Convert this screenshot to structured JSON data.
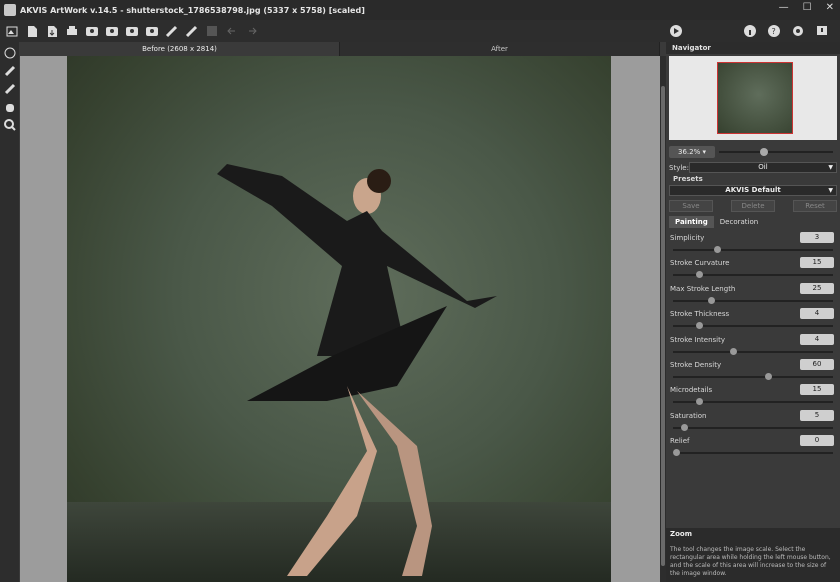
{
  "window": {
    "title": "AKVIS ArtWork v.14.5 - shutterstock_1786538798.jpg (5337 x 5758) [scaled]",
    "controls": [
      "minimize-icon",
      "maximize-icon",
      "close-icon"
    ]
  },
  "toolbar": {
    "icons": [
      "home-icon",
      "open-icon",
      "save-icon",
      "print-icon",
      "import-preset-icon",
      "export-preset-icon",
      "batch-icon",
      "share-icon",
      "brush-settings-icon",
      "brush-settings-2-icon",
      "disabled-tool-icon",
      "undo-icon",
      "redo-icon"
    ],
    "run_icon": "play-icon",
    "right_icons": [
      "info-icon",
      "help-icon",
      "settings-icon",
      "notification-icon"
    ]
  },
  "left_tools": [
    "magic-brush-icon",
    "paint-brush-icon",
    "eraser-icon",
    "hand-icon",
    "zoom-icon"
  ],
  "tabs": {
    "before": "Before (2608 x 2814)",
    "after": "After"
  },
  "navigator": {
    "title": "Navigator",
    "zoom": "36.2%",
    "zoom_level": 0.37
  },
  "style": {
    "label": "Style:",
    "value": "Oil"
  },
  "presets": {
    "label": "Presets",
    "value": "AKVIS Default",
    "save": "Save",
    "delete": "Delete",
    "reset": "Reset"
  },
  "panel_tabs": {
    "painting": "Painting",
    "decoration": "Decoration"
  },
  "params": [
    {
      "label": "Simplicity",
      "value": "3",
      "level": 0.27
    },
    {
      "label": "Stroke Curvature",
      "value": "15",
      "level": 0.15
    },
    {
      "label": "Max Stroke Length",
      "value": "25",
      "level": 0.23
    },
    {
      "label": "Stroke Thickness",
      "value": "4",
      "level": 0.15
    },
    {
      "label": "Stroke Intensity",
      "value": "4",
      "level": 0.37
    },
    {
      "label": "Stroke Density",
      "value": "60",
      "level": 0.6
    },
    {
      "label": "Microdetails",
      "value": "15",
      "level": 0.15
    },
    {
      "label": "Saturation",
      "value": "5",
      "level": 0.05
    },
    {
      "label": "Relief",
      "value": "0",
      "level": 0.0
    }
  ],
  "help": {
    "title": "Zoom",
    "text": "The tool changes the image scale. Select the rectangular area while holding the left mouse button, and the scale of this area will increase to the size of the image window."
  }
}
